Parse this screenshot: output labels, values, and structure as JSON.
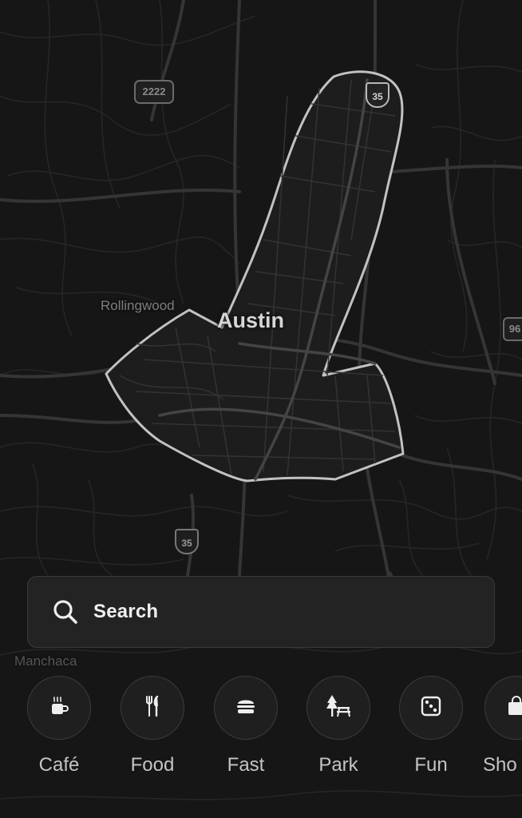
{
  "map": {
    "city": "Austin",
    "places": [
      "Rollingwood",
      "Manchaca"
    ],
    "shields": {
      "state_highway": "2222",
      "interstate_north": "35",
      "interstate_south": "35",
      "side_highway": "96"
    }
  },
  "search": {
    "label": "Search",
    "icon": "search-icon"
  },
  "categories": [
    {
      "label": "Café",
      "icon": "coffee-cup-icon"
    },
    {
      "label": "Food",
      "icon": "fork-knife-icon"
    },
    {
      "label": "Fast",
      "icon": "burger-icon"
    },
    {
      "label": "Park",
      "icon": "tree-bench-icon"
    },
    {
      "label": "Fun",
      "icon": "dice-icon"
    },
    {
      "label": "Sho",
      "icon": "shopping-bag-icon"
    }
  ],
  "colors": {
    "background": "#161616",
    "road": "#2f2f2f",
    "highway": "#3d3d3d",
    "outline": "#bdbdbd",
    "panel": "#232323",
    "text": "#efefef"
  }
}
